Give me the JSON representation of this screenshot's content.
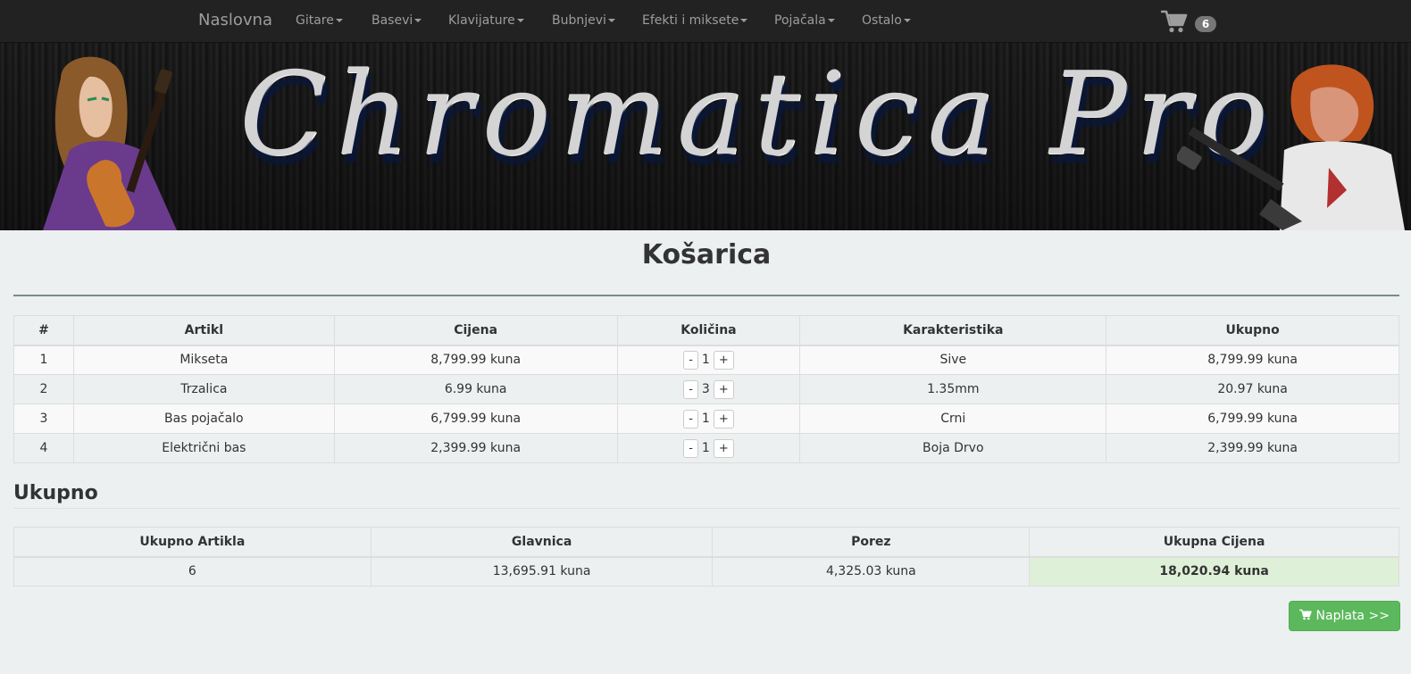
{
  "navbar": {
    "brand": "Naslovna",
    "items": [
      {
        "label": "Gitare"
      },
      {
        "label": "Basevi"
      },
      {
        "label": "Klavijature"
      },
      {
        "label": "Bubnjevi"
      },
      {
        "label": "Efekti i miksete"
      },
      {
        "label": "Pojačala"
      },
      {
        "label": "Ostalo"
      }
    ],
    "cart_icon": "shopping-cart-icon",
    "cart_count": "6"
  },
  "banner": {
    "title": "Chromatica Pro"
  },
  "page": {
    "title": "Košarica"
  },
  "cart_table": {
    "headers": [
      "#",
      "Artikl",
      "Cijena",
      "Količina",
      "Karakteristika",
      "Ukupno"
    ],
    "rows": [
      {
        "num": "1",
        "item": "Mikseta",
        "price": "8,799.99 kuna",
        "qty": "1",
        "feature": "Sive",
        "total": "8,799.99 kuna"
      },
      {
        "num": "2",
        "item": "Trzalica",
        "price": "6.99 kuna",
        "qty": "3",
        "feature": "1.35mm",
        "total": "20.97 kuna"
      },
      {
        "num": "3",
        "item": "Bas pojačalo",
        "price": "6,799.99 kuna",
        "qty": "1",
        "feature": "Crni",
        "total": "6,799.99 kuna"
      },
      {
        "num": "4",
        "item": "Električni bas",
        "price": "2,399.99 kuna",
        "qty": "1",
        "feature": "Boja Drvo",
        "total": "2,399.99 kuna"
      }
    ],
    "minus_label": "-",
    "plus_label": "+"
  },
  "summary": {
    "heading": "Ukupno",
    "headers": [
      "Ukupno Artikla",
      "Glavnica",
      "Porez",
      "Ukupna Cijena"
    ],
    "values": {
      "count": "6",
      "principal": "13,695.91 kuna",
      "tax": "4,325.03 kuna",
      "total": "18,020.94 kuna"
    }
  },
  "checkout": {
    "icon": "shopping-cart-icon",
    "label": "Naplata >>"
  },
  "colors": {
    "navbar_bg": "#222222",
    "page_bg": "#ecf0f1",
    "success": "#5cb85c",
    "total_highlight": "#dff0d8",
    "banner_text_shadow": "#0a1738"
  }
}
